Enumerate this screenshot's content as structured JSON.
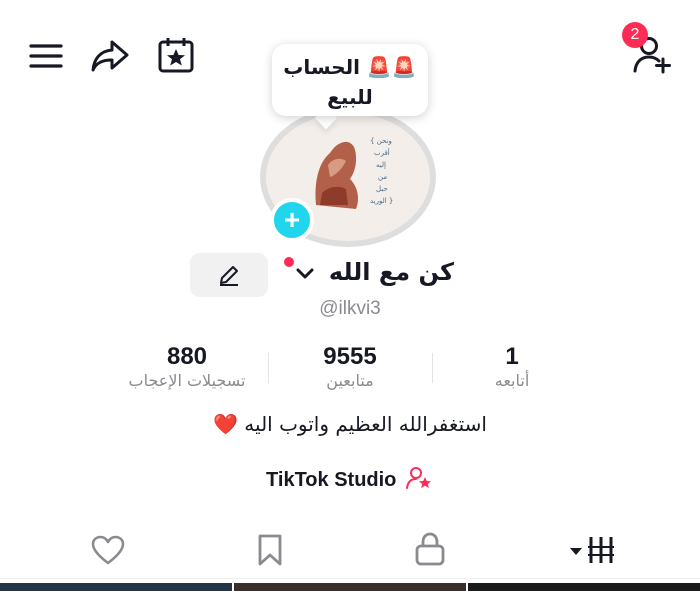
{
  "header": {
    "menu_icon": "hamburger-icon",
    "share_icon": "share-arrow-icon",
    "calendar_icon": "calendar-star-icon",
    "friends_icon": "add-person-icon",
    "friends_badge": "2"
  },
  "bubble": {
    "line1": "🚨🚨 الحساب",
    "line2": "للبيع"
  },
  "profile": {
    "display_name": "كن مع الله",
    "handle": "@ilkvi3",
    "edit_icon": "pencil-icon",
    "avatar_plus": "+"
  },
  "stats": [
    {
      "value": "880",
      "label": "تسجيلات الإعجاب"
    },
    {
      "value": "9555",
      "label": "متابعين"
    },
    {
      "value": "1",
      "label": "أتابعه"
    }
  ],
  "bio": "استغفرالله العظيم واتوب اليه ❤️",
  "studio": {
    "label": "TikTok Studio",
    "icon": "person-star-icon"
  },
  "tabs": [
    {
      "icon": "heart-icon"
    },
    {
      "icon": "bookmark-icon"
    },
    {
      "icon": "lock-icon"
    },
    {
      "icon": "grid-icon",
      "active": true
    }
  ],
  "colors": {
    "accent": "#fe2c55",
    "cyan": "#20d5ec",
    "muted": "#8a8b91"
  }
}
